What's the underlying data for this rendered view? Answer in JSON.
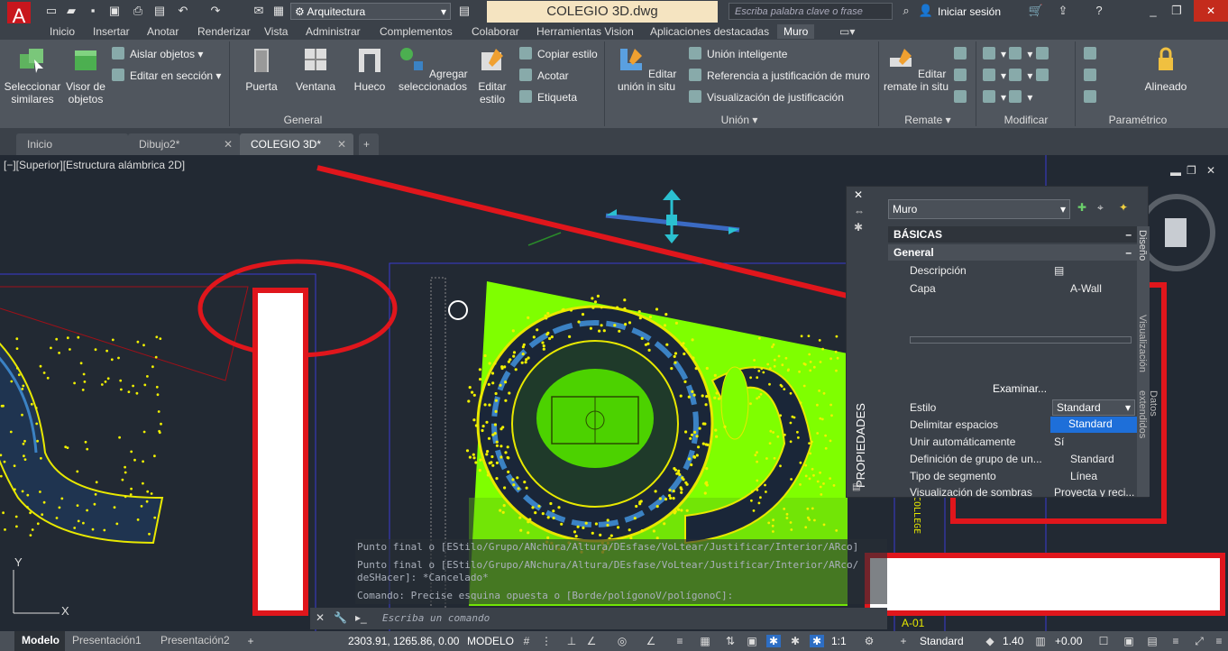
{
  "app": {
    "logo": "A",
    "workspace": "Arquitectura",
    "doc_title": "COLEGIO 3D.dwg",
    "search_placeholder": "Escriba palabra clave o frase",
    "signin": "Iniciar sesión"
  },
  "ribbon_tabs": [
    "Inicio",
    "Insertar",
    "Anotar",
    "Renderizar",
    "Vista",
    "Administrar",
    "Complementos",
    "Colaborar",
    "Herramientas Vision",
    "Aplicaciones destacadas",
    "Muro"
  ],
  "ribbon": {
    "seleccionar": "Seleccionar similares",
    "visor": "Visor de objetos",
    "aislar": "Aislar objetos",
    "editar_seccion": "Editar en sección",
    "puerta": "Puerta",
    "ventana": "Ventana",
    "hueco": "Hueco",
    "agregar": "Agregar seleccionados",
    "editar_estilo": "Editar estilo",
    "copiar_estilo": "Copiar estilo",
    "acotar": "Acotar",
    "etiqueta": "Etiqueta",
    "panel_general": "General",
    "editar_union": "Editar unión in situ",
    "union_inteligente": "Unión inteligente",
    "referencia": "Referencia a justificación de muro",
    "visualizacion": "Visualización de justificación",
    "panel_union": "Unión",
    "editar_remate": "Editar remate in situ",
    "panel_remate": "Remate",
    "panel_modificar": "Modificar",
    "alineado": "Alineado",
    "panel_parametrico": "Paramétrico"
  },
  "doc_tabs": [
    {
      "label": "Inicio"
    },
    {
      "label": "Dibujo2*"
    },
    {
      "label": "COLEGIO 3D*"
    }
  ],
  "viewport_label": "[−][Superior][Estructura alámbrica 2D]",
  "properties": {
    "object_type": "Muro",
    "section": "BÁSICAS",
    "subsection": "General",
    "side_title": "PROPIEDADES",
    "tab_diseno": "Diseño",
    "tab_visualizacion": "Visualización",
    "tab_datos": "Datos extendidos",
    "examinar": "Examinar...",
    "rows": [
      {
        "label": "Descripción",
        "value": ""
      },
      {
        "label": "Capa",
        "value": "A-Wall"
      },
      {
        "label": "Estilo",
        "value": "Standard"
      },
      {
        "label": "Delimitar espacios",
        "value": "Standard"
      },
      {
        "label": "Unir automáticamente",
        "value": "Sí"
      },
      {
        "label": "Definición de grupo de un...",
        "value": "Standard"
      },
      {
        "label": "Tipo de segmento",
        "value": "Línea"
      },
      {
        "label": "Visualización de sombras",
        "value": "Proyecta y reci..."
      }
    ]
  },
  "command_lines": [
    "Punto final o [EStilo/Grupo/ANchura/Altura/DEsfase/VoLtear/Justificar/Interior/ARco]",
    "Punto final o [EStilo/Grupo/ANchura/Altura/DEsfase/VoLtear/Justificar/Interior/ARco/",
    "deSHacer]: *Cancelado*",
    "Comando: Precise esquina opuesta o [Borde/polígonoV/polígonoC]:"
  ],
  "command_placeholder": "Escriba un comando",
  "layout_tabs": [
    "Modelo",
    "Presentación1",
    "Presentación2"
  ],
  "status": {
    "coords": "2303.91, 1265.86, 0.00",
    "mode": "MODELO",
    "scale": "1:1",
    "style": "Standard",
    "lineweight": "1.40",
    "offset": "+0.00"
  },
  "drawing_text": {
    "vertical": "COLLEGE",
    "sheet": "A-01"
  },
  "colors": {
    "accent_red": "#e0161c",
    "drawing_green": "#7fff00",
    "drawing_yellow": "#f0f000"
  }
}
